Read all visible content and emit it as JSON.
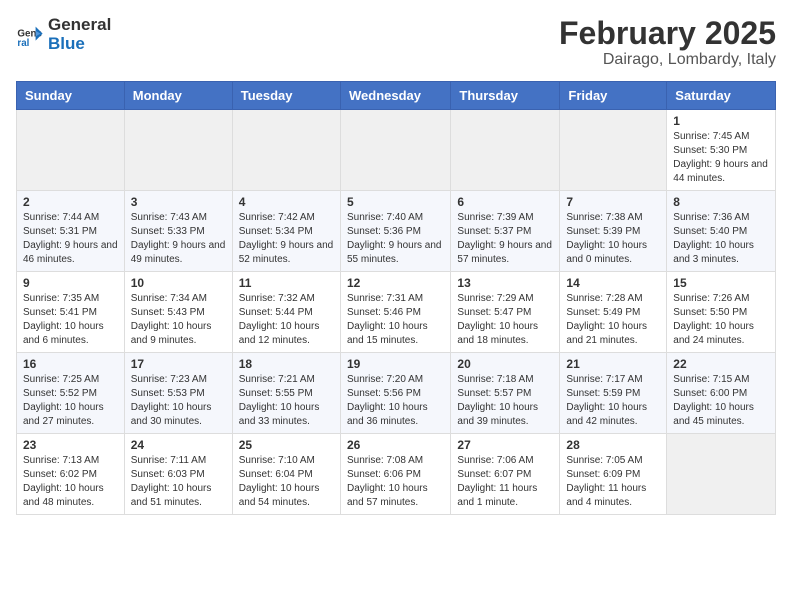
{
  "header": {
    "logo_line1": "General",
    "logo_line2": "Blue",
    "main_title": "February 2025",
    "subtitle": "Dairago, Lombardy, Italy"
  },
  "days_of_week": [
    "Sunday",
    "Monday",
    "Tuesday",
    "Wednesday",
    "Thursday",
    "Friday",
    "Saturday"
  ],
  "weeks": [
    [
      {
        "day": "",
        "info": ""
      },
      {
        "day": "",
        "info": ""
      },
      {
        "day": "",
        "info": ""
      },
      {
        "day": "",
        "info": ""
      },
      {
        "day": "",
        "info": ""
      },
      {
        "day": "",
        "info": ""
      },
      {
        "day": "1",
        "info": "Sunrise: 7:45 AM\nSunset: 5:30 PM\nDaylight: 9 hours and 44 minutes."
      }
    ],
    [
      {
        "day": "2",
        "info": "Sunrise: 7:44 AM\nSunset: 5:31 PM\nDaylight: 9 hours and 46 minutes."
      },
      {
        "day": "3",
        "info": "Sunrise: 7:43 AM\nSunset: 5:33 PM\nDaylight: 9 hours and 49 minutes."
      },
      {
        "day": "4",
        "info": "Sunrise: 7:42 AM\nSunset: 5:34 PM\nDaylight: 9 hours and 52 minutes."
      },
      {
        "day": "5",
        "info": "Sunrise: 7:40 AM\nSunset: 5:36 PM\nDaylight: 9 hours and 55 minutes."
      },
      {
        "day": "6",
        "info": "Sunrise: 7:39 AM\nSunset: 5:37 PM\nDaylight: 9 hours and 57 minutes."
      },
      {
        "day": "7",
        "info": "Sunrise: 7:38 AM\nSunset: 5:39 PM\nDaylight: 10 hours and 0 minutes."
      },
      {
        "day": "8",
        "info": "Sunrise: 7:36 AM\nSunset: 5:40 PM\nDaylight: 10 hours and 3 minutes."
      }
    ],
    [
      {
        "day": "9",
        "info": "Sunrise: 7:35 AM\nSunset: 5:41 PM\nDaylight: 10 hours and 6 minutes."
      },
      {
        "day": "10",
        "info": "Sunrise: 7:34 AM\nSunset: 5:43 PM\nDaylight: 10 hours and 9 minutes."
      },
      {
        "day": "11",
        "info": "Sunrise: 7:32 AM\nSunset: 5:44 PM\nDaylight: 10 hours and 12 minutes."
      },
      {
        "day": "12",
        "info": "Sunrise: 7:31 AM\nSunset: 5:46 PM\nDaylight: 10 hours and 15 minutes."
      },
      {
        "day": "13",
        "info": "Sunrise: 7:29 AM\nSunset: 5:47 PM\nDaylight: 10 hours and 18 minutes."
      },
      {
        "day": "14",
        "info": "Sunrise: 7:28 AM\nSunset: 5:49 PM\nDaylight: 10 hours and 21 minutes."
      },
      {
        "day": "15",
        "info": "Sunrise: 7:26 AM\nSunset: 5:50 PM\nDaylight: 10 hours and 24 minutes."
      }
    ],
    [
      {
        "day": "16",
        "info": "Sunrise: 7:25 AM\nSunset: 5:52 PM\nDaylight: 10 hours and 27 minutes."
      },
      {
        "day": "17",
        "info": "Sunrise: 7:23 AM\nSunset: 5:53 PM\nDaylight: 10 hours and 30 minutes."
      },
      {
        "day": "18",
        "info": "Sunrise: 7:21 AM\nSunset: 5:55 PM\nDaylight: 10 hours and 33 minutes."
      },
      {
        "day": "19",
        "info": "Sunrise: 7:20 AM\nSunset: 5:56 PM\nDaylight: 10 hours and 36 minutes."
      },
      {
        "day": "20",
        "info": "Sunrise: 7:18 AM\nSunset: 5:57 PM\nDaylight: 10 hours and 39 minutes."
      },
      {
        "day": "21",
        "info": "Sunrise: 7:17 AM\nSunset: 5:59 PM\nDaylight: 10 hours and 42 minutes."
      },
      {
        "day": "22",
        "info": "Sunrise: 7:15 AM\nSunset: 6:00 PM\nDaylight: 10 hours and 45 minutes."
      }
    ],
    [
      {
        "day": "23",
        "info": "Sunrise: 7:13 AM\nSunset: 6:02 PM\nDaylight: 10 hours and 48 minutes."
      },
      {
        "day": "24",
        "info": "Sunrise: 7:11 AM\nSunset: 6:03 PM\nDaylight: 10 hours and 51 minutes."
      },
      {
        "day": "25",
        "info": "Sunrise: 7:10 AM\nSunset: 6:04 PM\nDaylight: 10 hours and 54 minutes."
      },
      {
        "day": "26",
        "info": "Sunrise: 7:08 AM\nSunset: 6:06 PM\nDaylight: 10 hours and 57 minutes."
      },
      {
        "day": "27",
        "info": "Sunrise: 7:06 AM\nSunset: 6:07 PM\nDaylight: 11 hours and 1 minute."
      },
      {
        "day": "28",
        "info": "Sunrise: 7:05 AM\nSunset: 6:09 PM\nDaylight: 11 hours and 4 minutes."
      },
      {
        "day": "",
        "info": ""
      }
    ]
  ]
}
